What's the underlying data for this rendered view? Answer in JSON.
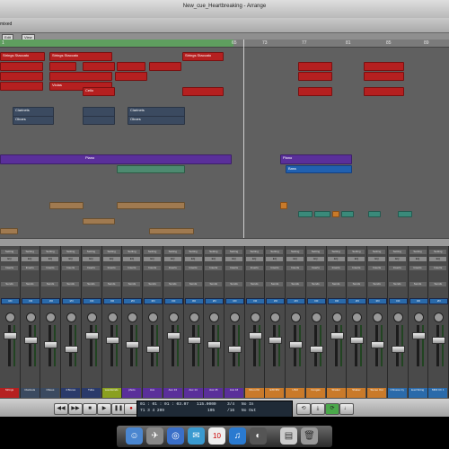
{
  "window": {
    "title": "New_cue_Heartbreaking - Arrange"
  },
  "toolbar": {
    "selector_label": "mixed",
    "edit_label": "Edit",
    "view_label": "View"
  },
  "ruler": {
    "ticks": [
      "1",
      "65",
      "73",
      "77",
      "81",
      "85",
      "89",
      "93",
      "97",
      "101",
      "105"
    ]
  },
  "arrange": {
    "regions": [
      {
        "label": "Strings Staccato",
        "color": "red"
      },
      {
        "label": "Cello",
        "color": "red"
      },
      {
        "label": "Violas",
        "color": "red"
      },
      {
        "label": "Clarinets",
        "color": "slate"
      },
      {
        "label": "Oboes",
        "color": "slate"
      },
      {
        "label": "Piano",
        "color": "purple"
      },
      {
        "label": "Bass",
        "color": "bluebright"
      }
    ]
  },
  "mixer": {
    "row_labels": {
      "setting": "Setting",
      "eq": "EQ",
      "inserts": "Inserts",
      "sends": "Sends",
      "io": "I/O"
    },
    "channels": [
      {
        "name": "Strings",
        "color": "#b52020"
      },
      {
        "name": "Clarinets",
        "color": "#3b4a60"
      },
      {
        "name": "Oboes",
        "color": "#3b4a60"
      },
      {
        "name": "4 Bones",
        "color": "#2a3a6a"
      },
      {
        "name": "Tuba",
        "color": "#2a3a6a"
      },
      {
        "name": "woodwinds",
        "color": "#8aa020"
      },
      {
        "name": "photo",
        "color": "#5a2f9a"
      },
      {
        "name": "Aux",
        "color": "#5a2f9a"
      },
      {
        "name": "Aux 13",
        "color": "#5a2f9a"
      },
      {
        "name": "Aux 14",
        "color": "#5a2f9a"
      },
      {
        "name": "Aux 15",
        "color": "#5a2f9a"
      },
      {
        "name": "Aux 16",
        "color": "#5a2f9a"
      },
      {
        "name": "Drum Kit",
        "color": "#c97a2a"
      },
      {
        "name": "EXP.MV",
        "color": "#c97a2a"
      },
      {
        "name": "USO",
        "color": "#c97a2a"
      },
      {
        "name": "Congas",
        "color": "#c97a2a"
      },
      {
        "name": "Shaker",
        "color": "#c97a2a"
      },
      {
        "name": "Shaker",
        "color": "#c97a2a"
      },
      {
        "name": "Stereo Out",
        "color": "#c97a2a"
      },
      {
        "name": "Chinese Cy",
        "color": "#2a6aaa"
      },
      {
        "name": "lead String",
        "color": "#2a6aaa"
      },
      {
        "name": "MIDI Ch 1",
        "color": "#2a6aaa"
      }
    ]
  },
  "transport": {
    "position": "01 : 01 : 01 : 03.07",
    "bars": "71 3 4 209",
    "tempo": "115.0000",
    "signature": "3/4",
    "division": "/16",
    "in_label": "No In",
    "out_label": "No Out",
    "cpu": "105"
  },
  "dock": {
    "calendar_day": "10"
  }
}
